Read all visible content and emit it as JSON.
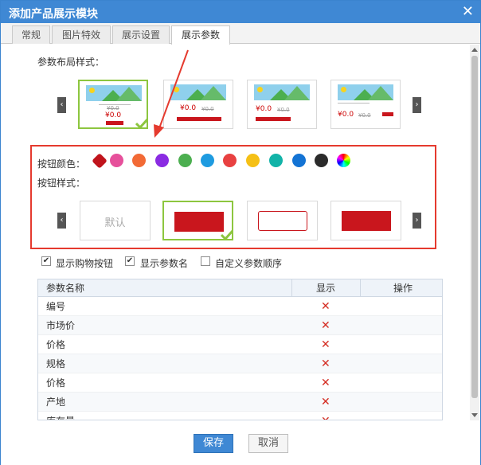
{
  "dialog": {
    "title": "添加产品展示模块",
    "close_glyph": "✕"
  },
  "tabs": [
    {
      "label": "常规"
    },
    {
      "label": "图片特效"
    },
    {
      "label": "展示设置"
    },
    {
      "label": "展示参数",
      "active": true
    }
  ],
  "layout_section": {
    "label": "参数布局样式：",
    "prev": "‹",
    "next": "›",
    "cards": [
      {
        "price": "¥0.0",
        "old_price": "¥0.0",
        "selected": true
      },
      {
        "price": "¥0.0",
        "old_price": "¥0.0",
        "selected": false
      },
      {
        "price": "¥0.0",
        "old_price": "¥0.0",
        "selected": false
      },
      {
        "price": "¥0.0",
        "old_price": "¥0.0",
        "selected": false
      }
    ]
  },
  "button_color": {
    "label": "按钮颜色：",
    "swatches": [
      "#c0141c",
      "#e6509b",
      "#f26a36",
      "#8a2be2",
      "#4caf50",
      "#1e9be0",
      "#e84141",
      "#f5c016",
      "#12b3a8",
      "#1373d4",
      "#2b2b2b",
      "rainbow"
    ]
  },
  "button_style": {
    "label": "按钮样式：",
    "prev": "‹",
    "next": "›",
    "default_label": "默认",
    "selected_index": 1
  },
  "options": {
    "show_cart": {
      "label": "显示购物按钮",
      "checked": true
    },
    "show_param_name": {
      "label": "显示参数名",
      "checked": true
    },
    "custom_order": {
      "label": "自定义参数顺序",
      "checked": false
    }
  },
  "table": {
    "headers": {
      "name": "参数名称",
      "show": "显示",
      "action": "操作"
    },
    "rows": [
      {
        "name": "编号"
      },
      {
        "name": "市场价"
      },
      {
        "name": "价格"
      },
      {
        "name": "规格"
      },
      {
        "name": "价格"
      },
      {
        "name": "产地"
      },
      {
        "name": "库存量"
      }
    ],
    "hidden_mark": "✕"
  },
  "footer": {
    "save": "保存",
    "cancel": "取消"
  },
  "colors": {
    "accent": "#3f88d4",
    "highlight": "#e53a2e",
    "selected_border": "#8dc63f",
    "brand_red": "#c9161d"
  }
}
